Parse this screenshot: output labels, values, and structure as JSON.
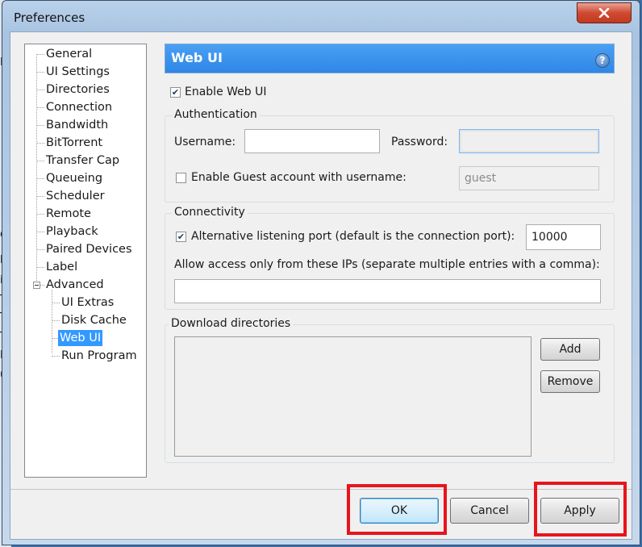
{
  "window": {
    "title": "Preferences"
  },
  "tree": {
    "items": [
      {
        "label": "General"
      },
      {
        "label": "UI Settings"
      },
      {
        "label": "Directories"
      },
      {
        "label": "Connection"
      },
      {
        "label": "Bandwidth"
      },
      {
        "label": "BitTorrent"
      },
      {
        "label": "Transfer Cap"
      },
      {
        "label": "Queueing"
      },
      {
        "label": "Scheduler"
      },
      {
        "label": "Remote"
      },
      {
        "label": "Playback"
      },
      {
        "label": "Paired Devices"
      },
      {
        "label": "Label"
      },
      {
        "label": "Advanced"
      }
    ],
    "advanced_children": [
      {
        "label": "UI Extras"
      },
      {
        "label": "Disk Cache"
      },
      {
        "label": "Web UI",
        "selected": true
      },
      {
        "label": "Run Program"
      }
    ]
  },
  "panel": {
    "title": "Web UI",
    "help_icon": "question-mark",
    "enable_web_ui": {
      "label": "Enable Web UI",
      "checked": true
    },
    "authentication": {
      "title": "Authentication",
      "username_label": "Username:",
      "username_value": "",
      "password_label": "Password:",
      "password_value": "",
      "guest_checkbox": {
        "label": "Enable Guest account with username:",
        "checked": false
      },
      "guest_value": "guest"
    },
    "connectivity": {
      "title": "Connectivity",
      "alt_port_checkbox": {
        "label": "Alternative listening port (default is the connection port):",
        "checked": true
      },
      "alt_port_value": "10000",
      "allow_ips_label": "Allow access only from these IPs (separate multiple entries with a comma):",
      "allow_ips_value": ""
    },
    "download_dirs": {
      "title": "Download directories",
      "add_label": "Add",
      "remove_label": "Remove"
    }
  },
  "footer": {
    "ok_label": "OK",
    "cancel_label": "Cancel",
    "apply_label": "Apply"
  },
  "colors": {
    "header": "#3391ea",
    "selection": "#3399ff",
    "highlight_box": "#e8141c"
  },
  "background_app": {
    "glyphs": [
      "L",
      "d",
      "li",
      "it",
      "T",
      "T",
      "T",
      "B",
      "u"
    ]
  }
}
